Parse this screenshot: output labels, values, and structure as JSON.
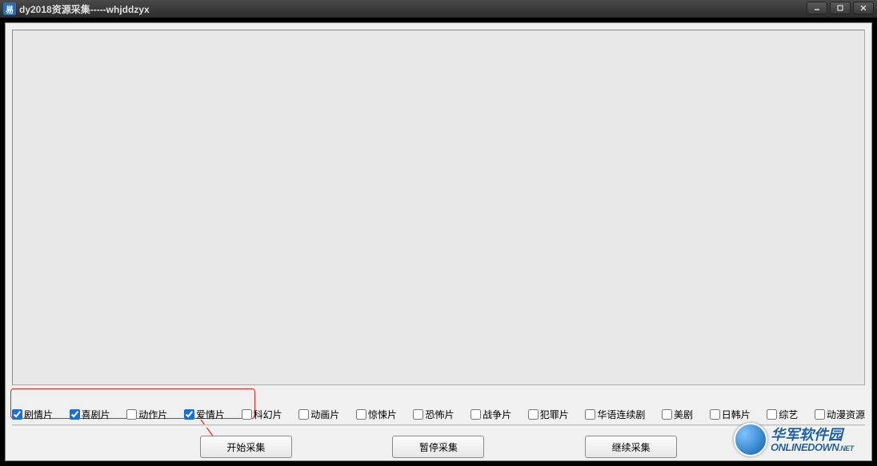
{
  "window": {
    "icon_text": "易",
    "title": "dy2018资源采集-----whjddzyx"
  },
  "categories": [
    {
      "label": "剧情片",
      "checked": true
    },
    {
      "label": "喜剧片",
      "checked": true
    },
    {
      "label": "动作片",
      "checked": false
    },
    {
      "label": "爱情片",
      "checked": true
    },
    {
      "label": "科幻片",
      "checked": false
    },
    {
      "label": "动画片",
      "checked": false
    },
    {
      "label": "惊悚片",
      "checked": false
    },
    {
      "label": "恐怖片",
      "checked": false
    },
    {
      "label": "战争片",
      "checked": false
    },
    {
      "label": "犯罪片",
      "checked": false
    },
    {
      "label": "华语连续剧",
      "checked": false
    },
    {
      "label": "美剧",
      "checked": false
    },
    {
      "label": "日韩片",
      "checked": false
    },
    {
      "label": "综艺",
      "checked": false
    },
    {
      "label": "动漫资源",
      "checked": false
    }
  ],
  "buttons": {
    "start": "开始采集",
    "pause": "暂停采集",
    "resume": "继续采集"
  },
  "watermark": {
    "cn": "华军软件园",
    "en": "ONLINEDOWN",
    "suffix": ".NET"
  }
}
